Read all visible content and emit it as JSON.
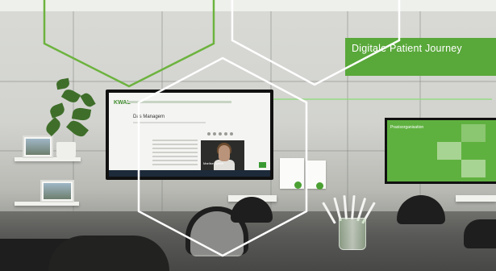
{
  "sign": {
    "text": "Digitale Patient Journey"
  },
  "left_screen": {
    "logo": "KWAL",
    "heading": "Das Managem",
    "video_caption": "Marlise Speck"
  },
  "right_screen": {
    "title": "Praxisorganisation"
  },
  "colors": {
    "brand_green": "#59a83a",
    "hexagon_white": "#ffffff",
    "hexagon_green": "#6db33f"
  }
}
